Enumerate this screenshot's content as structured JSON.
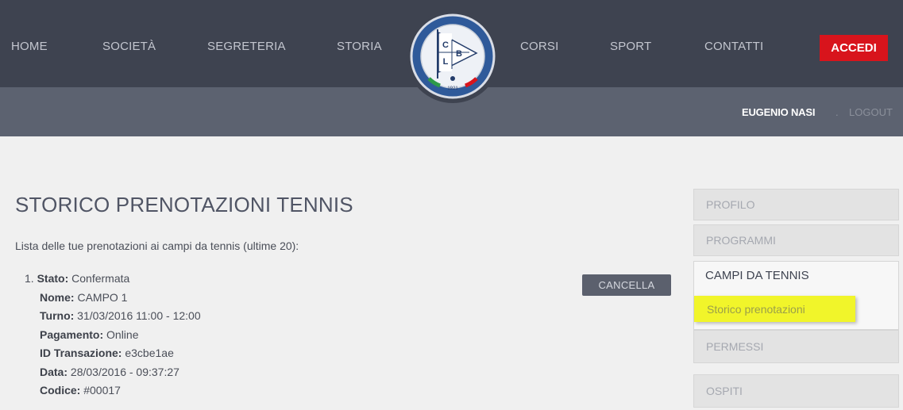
{
  "colors": {
    "topbar": "#3e4350",
    "subbar": "#5c6270",
    "accent_red": "#d8141c",
    "highlight_yellow": "#f1f52a"
  },
  "nav": {
    "left": [
      "HOME",
      "SOCIETÀ",
      "SEGRETERIA",
      "STORIA"
    ],
    "right": [
      "CORSI",
      "SPORT",
      "CONTATTI"
    ],
    "login_label": "ACCEDI"
  },
  "logo": {
    "letters": [
      "C",
      "L",
      "B"
    ],
    "year": "1921",
    "icon": "club-pennant-logo"
  },
  "user": {
    "name": "EUGENIO NASI",
    "separator": ".",
    "logout_label": "LOGOUT"
  },
  "main": {
    "title": "STORICO PRENOTAZIONI TENNIS",
    "intro": "Lista delle tue prenotazioni ai campi da tennis (ultime 20):",
    "cancel_label": "CANCELLA",
    "booking": {
      "number": "1.",
      "fields": [
        {
          "label": "Stato:",
          "value": "Confermata"
        },
        {
          "label": "Nome:",
          "value": "CAMPO 1"
        },
        {
          "label": "Turno:",
          "value": "31/03/2016 11:00 - 12:00"
        },
        {
          "label": "Pagamento:",
          "value": "Online"
        },
        {
          "label": "ID Transazione:",
          "value": "e3cbe1ae"
        },
        {
          "label": "Data:",
          "value": "28/03/2016 - 09:37:27"
        },
        {
          "label": "Codice:",
          "value": "#00017"
        }
      ]
    }
  },
  "sidebar": {
    "profile": "PROFILO",
    "programs": "PROGRAMMI",
    "tennis": "CAMPI DA TENNIS",
    "history": "Storico prenotazioni",
    "permits": "PERMESSI",
    "guests": "OSPITI"
  }
}
